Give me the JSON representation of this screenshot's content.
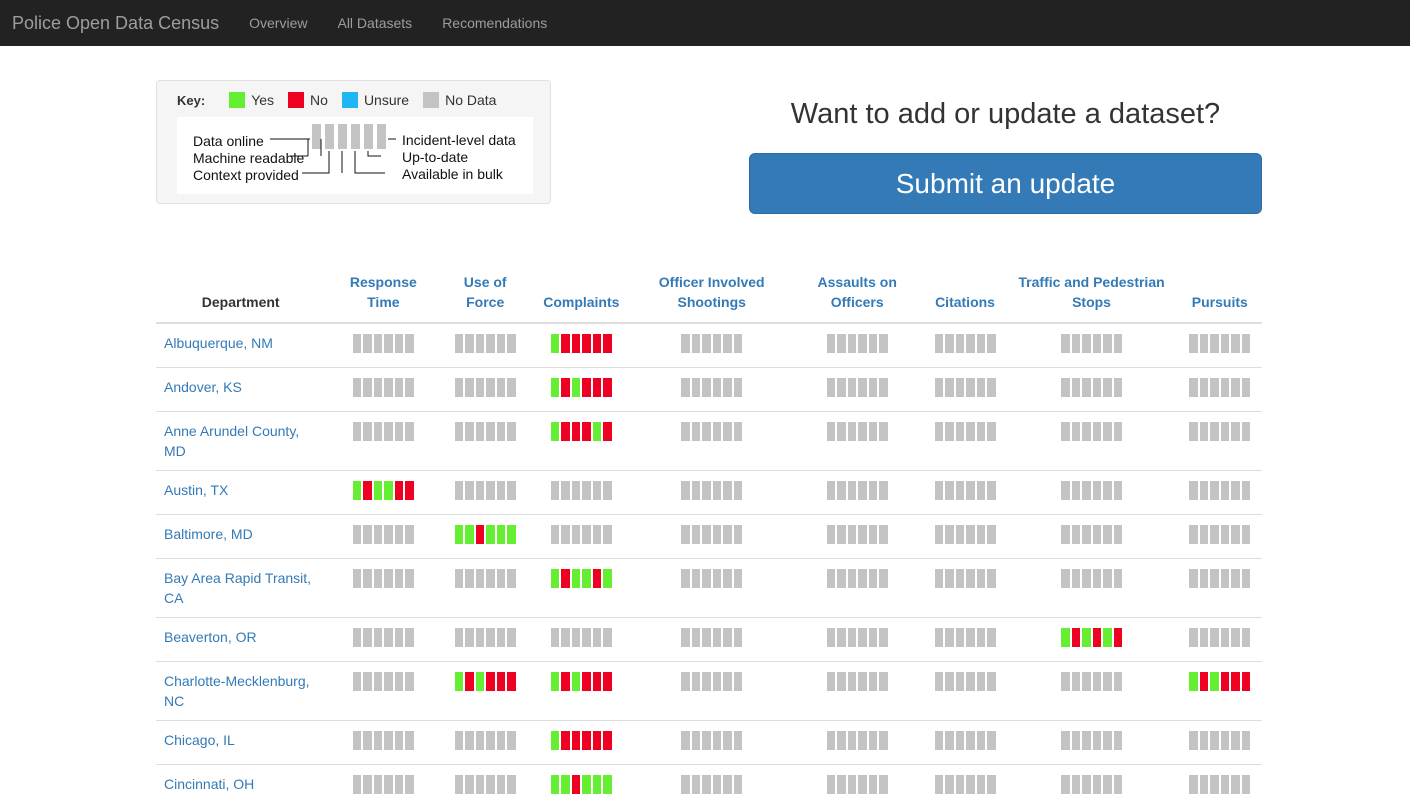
{
  "nav": {
    "brand": "Police Open Data Census",
    "links": [
      "Overview",
      "All Datasets",
      "Recomendations"
    ]
  },
  "colors": {
    "yes": "#66ee33",
    "no": "#ee0022",
    "unsure": "#1fb6f2",
    "nodata": "#c3c3c3"
  },
  "key": {
    "title": "Key:",
    "items": [
      {
        "label": "Yes",
        "status": "yes"
      },
      {
        "label": "No",
        "status": "no"
      },
      {
        "label": "Unsure",
        "status": "unsure"
      },
      {
        "label": "No Data",
        "status": "nodata"
      }
    ],
    "left_labels": [
      "Data online",
      "Machine readable",
      "Context provided"
    ],
    "right_labels": [
      "Incident-level data",
      "Up-to-date",
      "Available in bulk"
    ]
  },
  "cta": {
    "heading": "Want to add or update a dataset?",
    "button": "Submit an update"
  },
  "table": {
    "department_header": "Department",
    "columns": [
      [
        "Response",
        "Time"
      ],
      [
        "Use of",
        "Force"
      ],
      [
        "Complaints"
      ],
      [
        "Officer Involved",
        "Shootings"
      ],
      [
        "Assaults on",
        "Officers"
      ],
      [
        "Citations"
      ],
      [
        "Traffic and Pedestrian",
        "Stops"
      ],
      [
        "Pursuits"
      ]
    ],
    "rows": [
      {
        "dept": [
          "Albuquerque, NM"
        ],
        "cells": {
          "2": "ynnnnn"
        }
      },
      {
        "dept": [
          "Andover, KS"
        ],
        "cells": {
          "2": "ynynnn"
        }
      },
      {
        "dept": [
          "Anne Arundel County,",
          "MD"
        ],
        "cells": {
          "2": "ynnnyn"
        }
      },
      {
        "dept": [
          "Austin, TX"
        ],
        "cells": {
          "0": "ynyynn"
        }
      },
      {
        "dept": [
          "Baltimore, MD"
        ],
        "cells": {
          "1": "yynyyy"
        }
      },
      {
        "dept": [
          "Bay Area Rapid Transit,",
          "CA"
        ],
        "cells": {
          "2": "ynyyny"
        }
      },
      {
        "dept": [
          "Beaverton, OR"
        ],
        "cells": {
          "6": "ynynyn"
        }
      },
      {
        "dept": [
          "Charlotte-Mecklenburg,",
          "NC"
        ],
        "cells": {
          "1": "ynynnn",
          "2": "ynynnn",
          "7": "ynynnn"
        }
      },
      {
        "dept": [
          "Chicago, IL"
        ],
        "cells": {
          "2": "ynnnnn"
        }
      },
      {
        "dept": [
          "Cincinnati, OH"
        ],
        "cells": {
          "2": "yynyyy"
        }
      }
    ]
  }
}
